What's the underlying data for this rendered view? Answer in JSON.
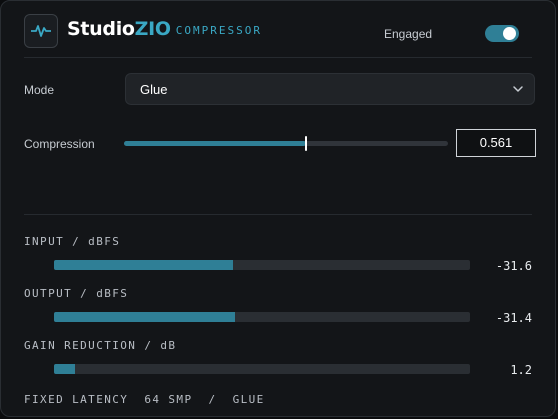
{
  "header": {
    "brand_name": "Studio",
    "brand_accent": "ZIO",
    "brand_sub": "COMPRESSOR",
    "logo_icon": "waveform-pulse-icon",
    "engaged_label": "Engaged",
    "engaged_on": true
  },
  "mode": {
    "label": "Mode",
    "value": "Glue",
    "icon": "chevron-down-icon"
  },
  "compression": {
    "label": "Compression",
    "value": "0.561",
    "fraction": 0.561
  },
  "meters": [
    {
      "label": "INPUT / dBFS",
      "value": "-31.6",
      "fill": 0.43
    },
    {
      "label": "OUTPUT / dBFS",
      "value": "-31.4",
      "fill": 0.434
    },
    {
      "label": "GAIN REDUCTION / dB",
      "value": "1.2",
      "fill": 0.05
    }
  ],
  "footer": {
    "text": "FIXED LATENCY  64 SMP  /  GLUE"
  },
  "colors": {
    "accent": "#3aa8c4",
    "fill": "#2f7f96",
    "background": "#131518"
  }
}
